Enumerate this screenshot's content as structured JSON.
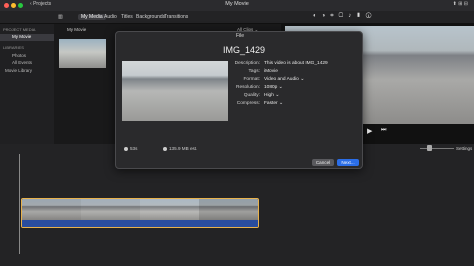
{
  "topbar": {
    "projects": "Projects",
    "title": "My Movie"
  },
  "media_tabs": [
    "My Media",
    "Audio",
    "Titles",
    "Backgrounds",
    "Transitions"
  ],
  "sidebar": {
    "project_media": "PROJECT MEDIA",
    "my_movie": "My Movie",
    "libraries": "LIBRARIES",
    "items": [
      "Photos",
      "All Events",
      "Movie Library"
    ]
  },
  "browser": {
    "title": "My Movie",
    "filter": "All Clips"
  },
  "timeline": {
    "settings": "Settings"
  },
  "dialog": {
    "heading": "File",
    "title": "IMG_1429",
    "fields": [
      {
        "label": "Description:",
        "value": "This video is about IMG_1429"
      },
      {
        "label": "Tags:",
        "value": "iMovie"
      },
      {
        "label": "Format:",
        "value": "Video and Audio"
      },
      {
        "label": "Resolution:",
        "value": "1080p"
      },
      {
        "label": "Quality:",
        "value": "High"
      },
      {
        "label": "Compress:",
        "value": "Faster"
      }
    ],
    "duration": "53s",
    "size": "135.9 MB est.",
    "cancel": "Cancel",
    "next": "Next..."
  },
  "colors": {
    "accent": "#2b6ee8",
    "clip_border": "#e8b24c",
    "audio": "#2a4d9e"
  }
}
